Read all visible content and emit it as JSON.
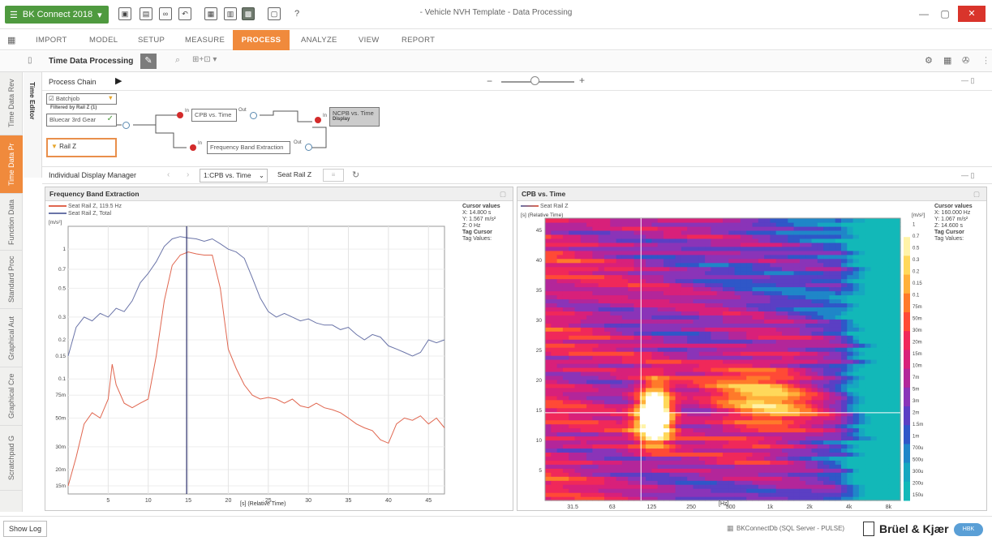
{
  "titlebar": {
    "app_button": "BK Connect 2018",
    "window_title": "- Vehicle NVH Template - Data Processing",
    "help": "?",
    "minimize": "—",
    "maximize": "▢",
    "close": "✕"
  },
  "menu": {
    "tabs": [
      "IMPORT",
      "MODEL",
      "SETUP",
      "MEASURE",
      "PROCESS",
      "ANALYZE",
      "VIEW",
      "REPORT"
    ],
    "active": "PROCESS"
  },
  "toolbar": {
    "title": "Time Data Processing"
  },
  "left_tabs": [
    "Time Data Rev",
    "Time Data Pr",
    "Function Data",
    "Standard Proc",
    "Graphical Aut",
    "Graphical Cre",
    "Scratchpad G"
  ],
  "left_active": "Time Data Pr",
  "sub_tab": "Time Editor",
  "process_chain": {
    "title": "Process Chain",
    "batchjob_label": "Batchjob",
    "batch_sub": "Filtered by Rail Z (1)",
    "source_value": "Bluecar 3rd Gear",
    "rail_label": "Rail Z",
    "cpb_node": "CPB vs. Time",
    "fbe_node": "Frequency Band Extraction",
    "display_node": "NCPB vs. Time",
    "display_sub": "Display",
    "in_label": "In",
    "out_label": "Out"
  },
  "display_manager": {
    "title": "Individual Display Manager",
    "selected": "1:CPB vs. Time",
    "channel": "Seat Rail Z"
  },
  "panel_left": {
    "title": "Frequency Band Extraction",
    "legend": [
      "Seat Rail Z, 119.5 Hz",
      "Seat Rail Z, Total"
    ],
    "y_unit": "[m/s²]",
    "x_axis_label": "[s] (Relative Time)",
    "cursor": {
      "heading": "Cursor values",
      "x": "X: 14.800 s",
      "y": "Y: 1.567 m/s²",
      "z": "Z: 0 Hz",
      "tag_cursor": "Tag Cursor",
      "tag_values": "Tag Values:"
    }
  },
  "panel_right": {
    "title": "CPB vs. Time",
    "legend": [
      "Seat Rail Z"
    ],
    "y_axis_label": "[s] (Relative Time)",
    "x_axis_label": "[Hz]",
    "scale_unit": "[m/s²]",
    "cursor": {
      "heading": "Cursor values",
      "x": "X: 160.000 Hz",
      "y": "Y: 1.067 m/s²",
      "z": "Z: 14.600 s",
      "tag_cursor": "Tag Cursor",
      "tag_values": "Tag Values:"
    }
  },
  "chart_data": [
    {
      "type": "line",
      "title": "Frequency Band Extraction",
      "xlabel": "[s] (Relative Time)",
      "ylabel": "[m/s²]",
      "y_scale": "log",
      "xlim": [
        0,
        47
      ],
      "ylim": [
        0.013,
        1.5
      ],
      "x_ticks": [
        5,
        10,
        15,
        20,
        25,
        30,
        35,
        40,
        45
      ],
      "y_ticks": [
        {
          "value": 1,
          "label": "1"
        },
        {
          "value": 0.7,
          "label": "0.7"
        },
        {
          "value": 0.5,
          "label": "0.5"
        },
        {
          "value": 0.3,
          "label": "0.3"
        },
        {
          "value": 0.2,
          "label": "0.2"
        },
        {
          "value": 0.15,
          "label": "0.15"
        },
        {
          "value": 0.1,
          "label": "0.1"
        },
        {
          "value": 0.075,
          "label": "75m"
        },
        {
          "value": 0.05,
          "label": "50m"
        },
        {
          "value": 0.03,
          "label": "30m"
        },
        {
          "value": 0.02,
          "label": "20m"
        },
        {
          "value": 0.015,
          "label": "15m"
        }
      ],
      "cursor_x": 14.8,
      "series": [
        {
          "name": "Seat Rail Z, 119.5 Hz",
          "color": "#e0664f",
          "x": [
            0,
            1,
            2,
            3,
            4,
            5,
            5.5,
            6,
            7,
            8,
            9,
            10,
            11,
            12,
            13,
            14,
            15,
            16,
            17,
            18,
            19,
            20,
            21,
            22,
            23,
            24,
            25,
            26,
            27,
            28,
            29,
            30,
            31,
            32,
            33,
            34,
            35,
            36,
            37,
            38,
            39,
            40,
            41,
            42,
            43,
            44,
            45,
            46,
            47
          ],
          "values": [
            0.015,
            0.025,
            0.045,
            0.055,
            0.05,
            0.07,
            0.13,
            0.09,
            0.065,
            0.06,
            0.065,
            0.07,
            0.15,
            0.4,
            0.75,
            0.9,
            0.95,
            0.92,
            0.9,
            0.9,
            0.5,
            0.17,
            0.12,
            0.09,
            0.075,
            0.07,
            0.072,
            0.07,
            0.065,
            0.07,
            0.062,
            0.06,
            0.065,
            0.06,
            0.058,
            0.055,
            0.05,
            0.045,
            0.042,
            0.04,
            0.034,
            0.032,
            0.045,
            0.05,
            0.048,
            0.052,
            0.045,
            0.05,
            0.042
          ]
        },
        {
          "name": "Seat Rail Z, Total",
          "color": "#6a74a8",
          "x": [
            0,
            1,
            2,
            3,
            4,
            5,
            6,
            7,
            8,
            9,
            10,
            11,
            12,
            13,
            14,
            15,
            16,
            17,
            18,
            19,
            20,
            21,
            22,
            23,
            24,
            25,
            26,
            27,
            28,
            29,
            30,
            31,
            32,
            33,
            34,
            35,
            36,
            37,
            38,
            39,
            40,
            41,
            42,
            43,
            44,
            45,
            46,
            47
          ],
          "values": [
            0.15,
            0.25,
            0.3,
            0.28,
            0.32,
            0.3,
            0.35,
            0.33,
            0.4,
            0.55,
            0.65,
            0.8,
            1.05,
            1.2,
            1.25,
            1.22,
            1.2,
            1.15,
            1.2,
            1.1,
            1.0,
            0.95,
            0.85,
            0.6,
            0.42,
            0.33,
            0.3,
            0.32,
            0.3,
            0.28,
            0.29,
            0.27,
            0.26,
            0.26,
            0.24,
            0.25,
            0.22,
            0.2,
            0.22,
            0.21,
            0.18,
            0.17,
            0.16,
            0.15,
            0.16,
            0.2,
            0.19,
            0.2
          ]
        }
      ]
    },
    {
      "type": "heatmap",
      "title": "CPB vs. Time",
      "xlabel": "[Hz]",
      "ylabel": "[s] (Relative Time)",
      "x_scale": "log",
      "x_ticks": [
        "31.5",
        "63",
        "125",
        "250",
        "500",
        "1k",
        "2k",
        "4k",
        "8k"
      ],
      "y_ticks": [
        5,
        10,
        15,
        20,
        25,
        30,
        35,
        40,
        45
      ],
      "ylim": [
        0,
        47
      ],
      "cursor_freq": "160 Hz",
      "cursor_time": 14.6,
      "colorbar_unit": "[m/s²]",
      "colorbar_ticks": [
        "1",
        "0.7",
        "0.5",
        "0.3",
        "0.2",
        "0.15",
        "0.1",
        "75m",
        "50m",
        "30m",
        "20m",
        "15m",
        "10m",
        "7m",
        "5m",
        "3m",
        "2m",
        "1.5m",
        "1m",
        "700u",
        "500u",
        "300u",
        "200u",
        "150u"
      ],
      "colormap": [
        "#ffffff",
        "#fff3a8",
        "#ffd85a",
        "#ffb03a",
        "#ff7a2a",
        "#ff4a36",
        "#f0285a",
        "#d8207a",
        "#b3269a",
        "#8a34b8",
        "#5b3fc4",
        "#2f57c8",
        "#1f86c8",
        "#16a7c0",
        "#12b8b8"
      ]
    }
  ],
  "statusbar": {
    "show_log": "Show Log",
    "db_label": "BKConnectDb (SQL Server - PULSE)",
    "brand": "Brüel & Kjær",
    "brand_sub": "HBK"
  }
}
